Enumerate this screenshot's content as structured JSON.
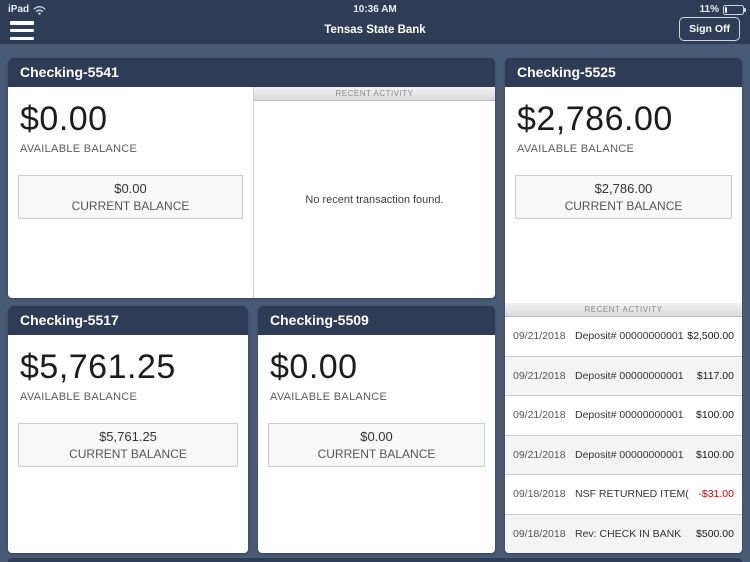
{
  "status_bar": {
    "device": "iPad",
    "time": "10:36 AM",
    "battery_percent": "11%"
  },
  "nav": {
    "title": "Tensas State Bank",
    "sign_off_label": "Sign Off"
  },
  "labels": {
    "available": "AVAILABLE BALANCE",
    "current": "CURRENT BALANCE",
    "recent_activity": "RECENT ACTIVITY",
    "no_transactions": "No recent transaction found."
  },
  "accounts": [
    {
      "name": "Checking-5541",
      "available": "$0.00",
      "current": "$0.00"
    },
    {
      "name": "Checking-5525",
      "available": "$2,786.00",
      "current": "$2,786.00"
    },
    {
      "name": "Checking-5517",
      "available": "$5,761.25",
      "current": "$5,761.25"
    },
    {
      "name": "Checking-5509",
      "available": "$0.00",
      "current": "$0.00"
    }
  ],
  "transactions": [
    {
      "date": "09/21/2018",
      "desc": "Deposit# 00000000001",
      "amount": "$2,500.00",
      "negative": false
    },
    {
      "date": "09/21/2018",
      "desc": "Deposit# 00000000001",
      "amount": "$117.00",
      "negative": false
    },
    {
      "date": "09/21/2018",
      "desc": "Deposit# 00000000001",
      "amount": "$100.00",
      "negative": false
    },
    {
      "date": "09/21/2018",
      "desc": "Deposit# 00000000001",
      "amount": "$100.00",
      "negative": false
    },
    {
      "date": "09/18/2018",
      "desc": "NSF RETURNED ITEM(",
      "amount": "-$31.00",
      "negative": true
    },
    {
      "date": "09/18/2018",
      "desc": "Rev: CHECK IN BANK",
      "amount": "$500.00",
      "negative": false
    }
  ],
  "colors": {
    "navbar_bg": "#2e3c55",
    "page_bg": "#485a74",
    "card_bg": "#ffffff",
    "negative_amount": "#cc0000"
  }
}
